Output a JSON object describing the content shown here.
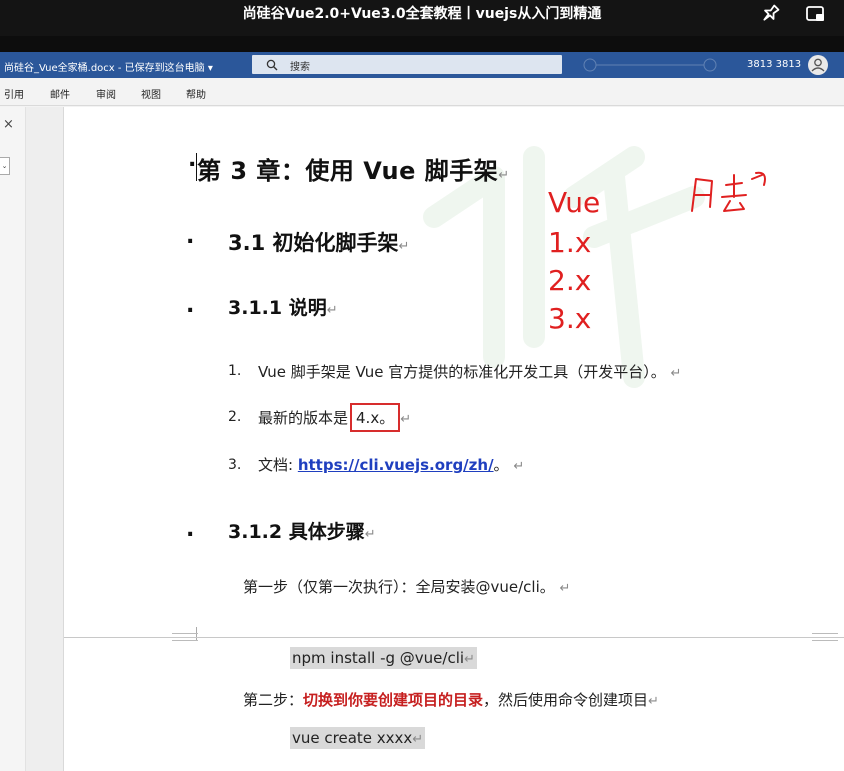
{
  "video": {
    "title": "尚硅谷Vue2.0+Vue3.0全套教程丨vuejs从入门到精通"
  },
  "word": {
    "doc_title": "尚硅谷_Vue全家桶.docx - 已保存到这台电脑 ▾",
    "search_placeholder": "搜索",
    "user": "3813 3813",
    "theme_color": "#2b579a"
  },
  "ribbon": {
    "tabs": [
      "引用",
      "邮件",
      "审阅",
      "视图",
      "帮助"
    ]
  },
  "nav": {
    "close": "×",
    "dropdown": "⌄"
  },
  "document": {
    "chapter_heading": "第 3 章：使用 Vue 脚手架",
    "section_heading": "3.1  初始化脚手架",
    "subsection1_heading": "3.1.1  说明",
    "list": [
      {
        "num": "1.",
        "text": "Vue 脚手架是 Vue 官方提供的标准化开发工具（开发平台）。"
      },
      {
        "num": "2.",
        "text_before": "最新的版本是",
        "highlight": "4.x。"
      },
      {
        "num": "3.",
        "text_before": "文档: ",
        "link": "https://cli.vuejs.org/zh/",
        "text_after": "。"
      }
    ],
    "subsection2_heading": "3.1.2  具体步骤",
    "step1": "第一步（仅第一次执行）：全局安装@vue/cli。",
    "code1": "npm install -g @vue/cli",
    "step2_prefix": "第二步：",
    "step2_bold": "切换到你要创建项目的目录",
    "step2_suffix": "，然后使用命令创建项目",
    "code2": "vue create xxxx",
    "paragraph_mark": "↵",
    "bullet": "."
  },
  "annotations": {
    "lines": [
      "Vue",
      "1.x",
      "2.x",
      "3.x"
    ],
    "color": "#e02020"
  }
}
